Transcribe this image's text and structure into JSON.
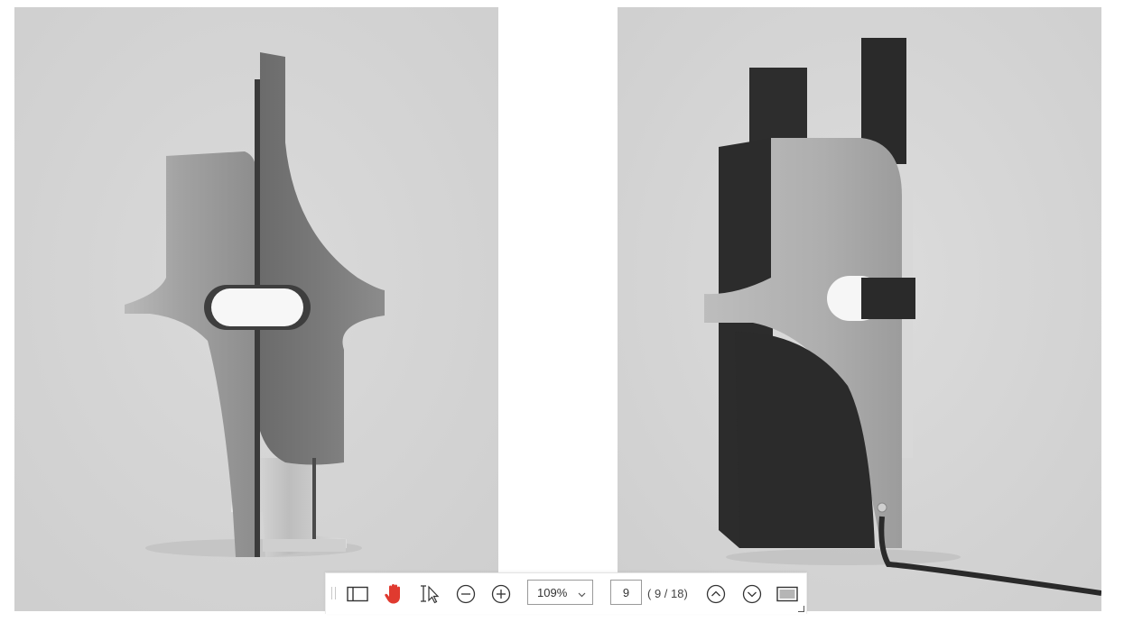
{
  "document": {
    "images": [
      {
        "name": "lamp-render-front-chrome",
        "background": "#d4d4d4"
      },
      {
        "name": "lamp-render-angled-black",
        "background": "#d4d4d4"
      }
    ]
  },
  "toolbar": {
    "tools": [
      {
        "name": "sidebar-toggle",
        "icon": "sidebar-icon"
      },
      {
        "name": "hand-tool",
        "icon": "hand-icon",
        "active": true,
        "color": "#e03a2f"
      },
      {
        "name": "text-select-tool",
        "icon": "text-cursor-icon"
      },
      {
        "name": "zoom-out",
        "icon": "minus-circle-icon"
      },
      {
        "name": "zoom-in",
        "icon": "plus-circle-icon"
      }
    ],
    "zoom": {
      "value": "109%",
      "icon": "chevron-down-icon"
    },
    "page": {
      "current": "9",
      "count_label": "( 9 / 18)"
    },
    "nav": [
      {
        "name": "previous-page",
        "icon": "chevron-up-circle-icon"
      },
      {
        "name": "next-page",
        "icon": "chevron-down-circle-icon"
      },
      {
        "name": "fit-view",
        "icon": "fit-page-icon"
      }
    ]
  }
}
